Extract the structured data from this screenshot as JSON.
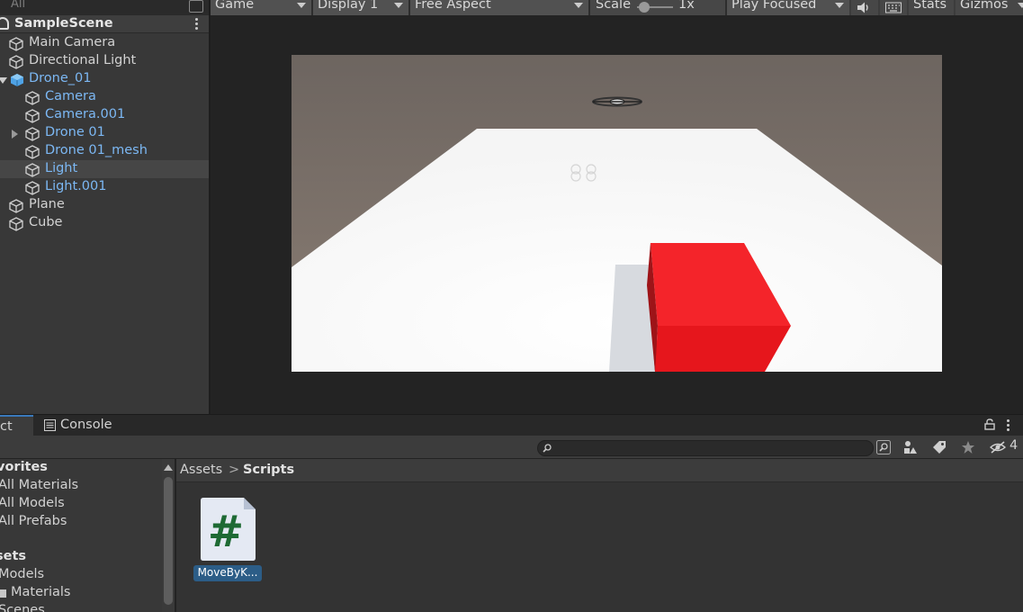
{
  "hierarchy": {
    "search_placeholder": "All",
    "scene_name": "SampleScene",
    "items": [
      {
        "label": "Main Camera",
        "prefab": false
      },
      {
        "label": "Directional Light",
        "prefab": false
      },
      {
        "label": "Drone_01",
        "prefab": true
      },
      {
        "label": "Camera",
        "prefab": true
      },
      {
        "label": "Camera.001",
        "prefab": true
      },
      {
        "label": "Drone 01",
        "prefab": true
      },
      {
        "label": "Drone 01_mesh",
        "prefab": true
      },
      {
        "label": "Light",
        "prefab": true,
        "selected": true
      },
      {
        "label": "Light.001",
        "prefab": true
      },
      {
        "label": "Plane",
        "prefab": false
      },
      {
        "label": "Cube",
        "prefab": false
      }
    ]
  },
  "game_toolbar": {
    "view_mode": "Game",
    "display": "Display 1",
    "aspect": "Free Aspect",
    "scale_label": "Scale",
    "scale_value": "1x",
    "play_mode": "Play Focused",
    "stats": "Stats",
    "gizmos": "Gizmos"
  },
  "scene_colors": {
    "sky_top": "#6d6560",
    "sky_bottom": "#8a7d73",
    "ground": "#f5f5f5",
    "cube_front": "#e6161c",
    "cube_top": "#f4242a",
    "cube_side": "#9e1418"
  },
  "bottom_panel": {
    "tabs": {
      "project": "ct",
      "console": "Console"
    },
    "layer_count": "4",
    "tree": {
      "favorites_header": "vorites",
      "favorites": [
        "All Materials",
        "All Models",
        "All Prefabs"
      ],
      "assets_header": "sets",
      "assets": [
        "Models",
        "Materials",
        "Scenes"
      ]
    },
    "breadcrumb": {
      "root": "Assets",
      "separator": ">",
      "current": "Scripts"
    },
    "files": [
      {
        "name": "MoveByK...",
        "icon": "csharp-script-icon",
        "glyph": "#"
      }
    ]
  }
}
